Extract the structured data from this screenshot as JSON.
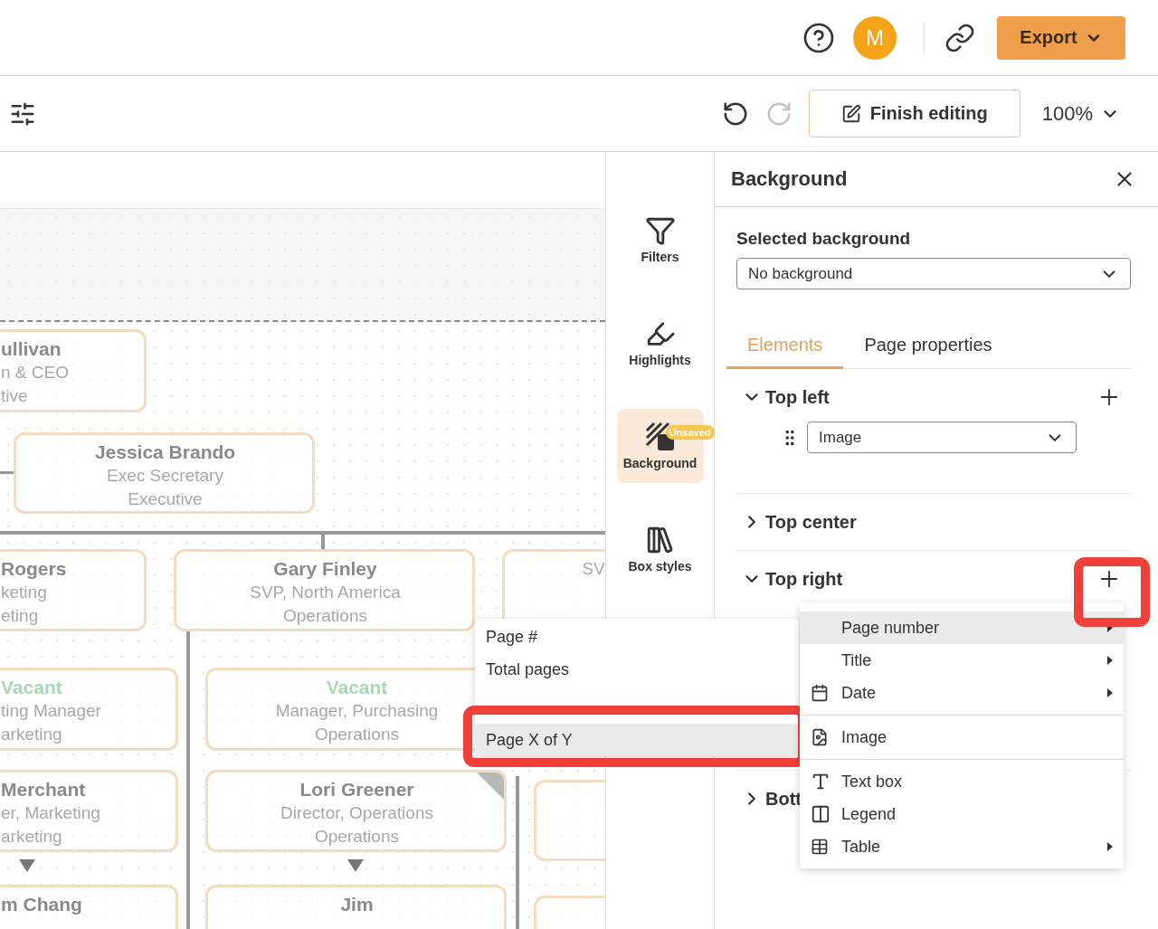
{
  "header": {
    "avatar_initial": "M",
    "export_label": "Export"
  },
  "toolbar": {
    "finish_label": "Finish editing",
    "zoom": "100%",
    "redo_disabled": true
  },
  "chart": {
    "cards": [
      {
        "lines": [
          {
            "kind": "name",
            "text": "ullivan"
          },
          {
            "kind": "title",
            "text": "n & CEO"
          },
          {
            "kind": "title",
            "text": "tive"
          }
        ]
      },
      {
        "lines": [
          {
            "kind": "name",
            "text": "Jessica Brando"
          },
          {
            "kind": "title",
            "text": "Exec Secretary"
          },
          {
            "kind": "title",
            "text": "Executive"
          }
        ]
      },
      {
        "lines": [
          {
            "kind": "name",
            "text": "Rogers"
          },
          {
            "kind": "title",
            "text": "keting"
          },
          {
            "kind": "title",
            "text": "eting"
          }
        ]
      },
      {
        "lines": [
          {
            "kind": "name",
            "text": "Gary Finley"
          },
          {
            "kind": "title",
            "text": "SVP, North America"
          },
          {
            "kind": "title",
            "text": "Operations"
          }
        ]
      },
      {
        "lines": [
          {
            "kind": "title",
            "text": "SV"
          }
        ]
      },
      {
        "lines": [
          {
            "kind": "vacant",
            "text": "Vacant"
          },
          {
            "kind": "title",
            "text": "ting Manager"
          },
          {
            "kind": "title",
            "text": "arketing"
          }
        ]
      },
      {
        "lines": [
          {
            "kind": "vacant",
            "text": "Vacant"
          },
          {
            "kind": "title",
            "text": "Manager, Purchasing"
          },
          {
            "kind": "title",
            "text": "Operations"
          }
        ]
      },
      {
        "lines": [
          {
            "kind": "name",
            "text": "Merchant"
          },
          {
            "kind": "title",
            "text": "er, Marketing"
          },
          {
            "kind": "title",
            "text": "arketing"
          }
        ]
      },
      {
        "lines": [
          {
            "kind": "name",
            "text": "Lori Greener"
          },
          {
            "kind": "title",
            "text": "Director, Operations"
          },
          {
            "kind": "title",
            "text": "Operations"
          }
        ],
        "tagged": true
      },
      {
        "lines": [
          {
            "kind": "name",
            "text": "m Chang"
          }
        ]
      },
      {
        "lines": [
          {
            "kind": "name",
            "text": "Jim"
          }
        ]
      }
    ]
  },
  "side_tools": [
    {
      "kind": "filter",
      "label": "Filters",
      "selected": false
    },
    {
      "kind": "highlight",
      "label": "Highlights",
      "selected": false
    },
    {
      "kind": "background",
      "label": "Background",
      "selected": true,
      "badge": "Unsaved"
    },
    {
      "kind": "boxstyles",
      "label": "Box styles",
      "selected": false
    }
  ],
  "panel": {
    "title": "Background",
    "selected_background": {
      "label": "Selected background",
      "value": "No background"
    },
    "tabs": [
      {
        "label": "Elements",
        "selected": true
      },
      {
        "label": "Page properties",
        "selected": false
      }
    ],
    "sections": [
      {
        "label": "Top left",
        "expanded": true,
        "items": [
          {
            "value": "Image"
          }
        ]
      },
      {
        "label": "Top center",
        "expanded": false
      },
      {
        "label": "Top right",
        "expanded": true
      },
      {
        "label": "Bott",
        "expanded": false
      }
    ]
  },
  "submenu": {
    "items": [
      {
        "label": "Page #",
        "selected": false
      },
      {
        "label": "Total pages",
        "selected": false
      },
      {
        "label": "Page X of Y",
        "selected": true
      }
    ]
  },
  "add_menu": {
    "groups": [
      [
        {
          "kind": "page",
          "label": "Page number",
          "submenu": true,
          "selected": true
        },
        {
          "kind": "title",
          "label": "Title",
          "submenu": true,
          "selected": false
        },
        {
          "kind": "date",
          "label": "Date",
          "submenu": true,
          "selected": false
        }
      ],
      [
        {
          "kind": "image",
          "label": "Image",
          "submenu": false,
          "selected": false
        }
      ],
      [
        {
          "kind": "text",
          "label": "Text box",
          "submenu": false,
          "selected": false
        },
        {
          "kind": "legend",
          "label": "Legend",
          "submenu": false,
          "selected": false
        },
        {
          "kind": "table",
          "label": "Table",
          "submenu": true,
          "selected": false
        }
      ]
    ]
  }
}
